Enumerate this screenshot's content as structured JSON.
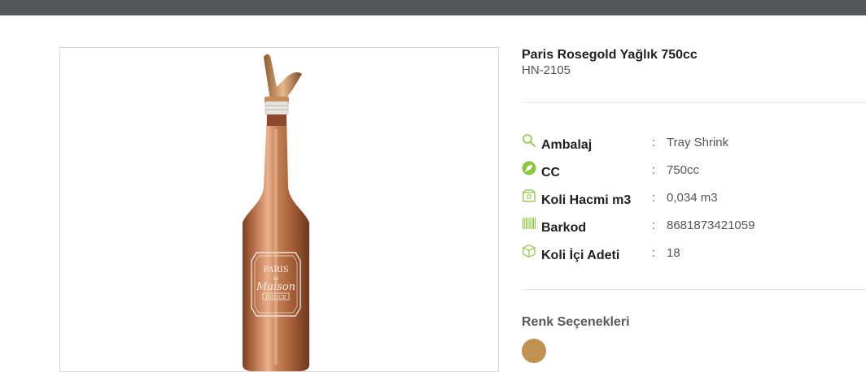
{
  "product": {
    "title": "Paris Rosegold Yağlık 750cc",
    "code": "HN-2105",
    "image_icon": "bottle-product-image",
    "bottle_label": {
      "line1": "PARIS",
      "line2": "la",
      "line3": "Maison",
      "line4": "DOUCE"
    }
  },
  "specs": [
    {
      "icon": "search-icon",
      "label": "Ambalaj",
      "value": "Tray Shrink"
    },
    {
      "icon": "leaf-icon",
      "label": "CC",
      "value": "750cc"
    },
    {
      "icon": "box-icon",
      "label": "Koli Hacmi m3",
      "value": "0,034 m3"
    },
    {
      "icon": "barcode-icon",
      "label": "Barkod",
      "value": "8681873421059"
    },
    {
      "icon": "cube-icon",
      "label": "Koli İçi Adeti",
      "value": "18"
    }
  ],
  "separator": ":",
  "colors": {
    "title": "Renk Seçenekleri",
    "options": [
      {
        "hex": "#c0924f"
      }
    ]
  },
  "theme": {
    "topbar": "#555659",
    "icon_green": "#8dc63f"
  }
}
